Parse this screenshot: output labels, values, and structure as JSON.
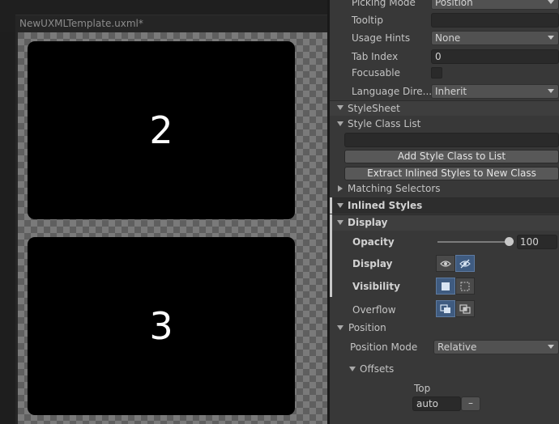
{
  "viewport": {
    "tab_title": "NewUXMLTemplate.uxml*",
    "cards": [
      "2",
      "3"
    ]
  },
  "inspector": {
    "picking_mode": {
      "label": "Picking Mode",
      "value": "Position"
    },
    "tooltip": {
      "label": "Tooltip",
      "value": ""
    },
    "usage_hints": {
      "label": "Usage Hints",
      "value": "None"
    },
    "tab_index": {
      "label": "Tab Index",
      "value": "0"
    },
    "focusable": {
      "label": "Focusable",
      "checked": false
    },
    "language_direction": {
      "label": "Language Dire...",
      "value": "Inherit"
    },
    "stylesheet": {
      "label": "StyleSheet"
    },
    "style_class_list": {
      "label": "Style Class List",
      "input_value": "",
      "add_button": "Add Style Class to List",
      "extract_button": "Extract Inlined Styles to New Class"
    },
    "matching_selectors": {
      "label": "Matching Selectors"
    },
    "inlined_styles": {
      "label": "Inlined Styles"
    },
    "display_section": {
      "label": "Display",
      "opacity": {
        "label": "Opacity",
        "value": "100",
        "level": 1.0
      },
      "display": {
        "label": "Display",
        "options": [
          "eye-icon",
          "eye-hidden-icon"
        ],
        "selected": "eye-hidden-icon"
      },
      "visibility": {
        "label": "Visibility",
        "options": [
          "visible-square-icon",
          "hidden-square-icon"
        ],
        "selected": "visible-square-icon"
      },
      "overflow": {
        "label": "Overflow",
        "options": [
          "overflow-visible-icon",
          "overflow-hidden-icon"
        ],
        "selected": "overflow-visible-icon"
      }
    },
    "position_section": {
      "label": "Position",
      "position_mode": {
        "label": "Position Mode",
        "value": "Relative"
      },
      "offsets": {
        "label": "Offsets",
        "top": {
          "label": "Top",
          "value": "auto",
          "unit": "–"
        }
      }
    }
  },
  "colors": {
    "toggle_selected": "#3f5b80",
    "panel_bg": "#383838",
    "canvas_checker": "#7a7a7a"
  }
}
